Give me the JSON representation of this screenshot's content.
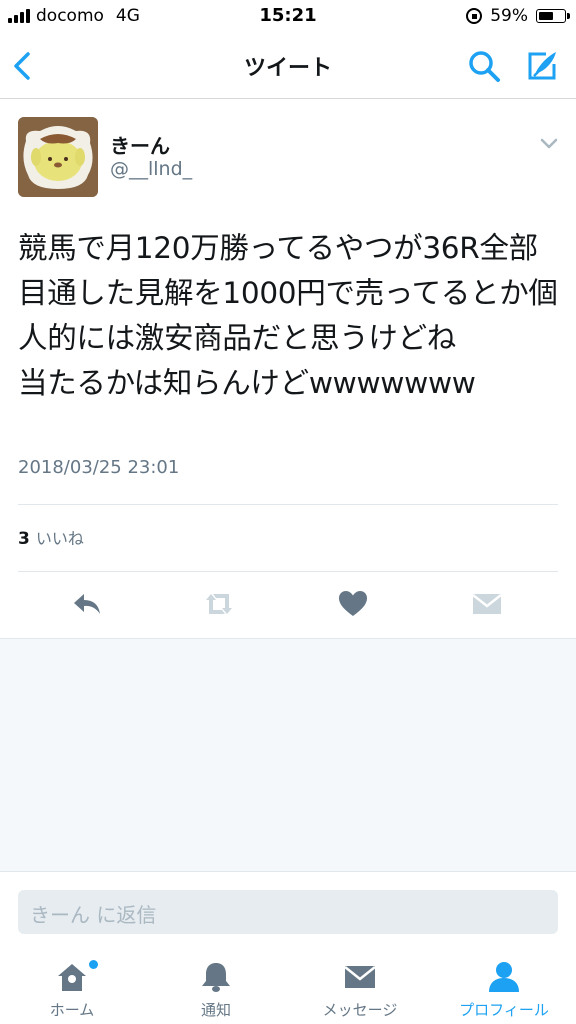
{
  "status_bar": {
    "carrier": "docomo",
    "network": "4G",
    "time": "15:21",
    "battery": "59%",
    "battery_level": 0.59
  },
  "nav": {
    "title": "ツイート",
    "back_icon": "chevron-left-icon",
    "search_icon": "search-icon",
    "compose_icon": "compose-icon"
  },
  "tweet": {
    "display_name": "きーん",
    "handle": "@__llnd_",
    "text": "競馬で月120万勝ってるやつが36R全部目通した見解を1000円で売ってるとか個人的には激安商品だと思うけどね\n当たるかは知らんけどwwwwwww",
    "timestamp": "2018/03/25 23:01",
    "likes_count": "3",
    "likes_label": "いいね"
  },
  "reply": {
    "placeholder": "きーん に返信"
  },
  "tabs": [
    {
      "label": "ホーム",
      "icon": "home-icon"
    },
    {
      "label": "通知",
      "icon": "bell-icon"
    },
    {
      "label": "メッセージ",
      "icon": "envelope-icon"
    },
    {
      "label": "プロフィール",
      "icon": "person-icon"
    }
  ],
  "colors": {
    "accent": "#1da1f2",
    "text": "#14171a",
    "secondary": "#657786"
  }
}
